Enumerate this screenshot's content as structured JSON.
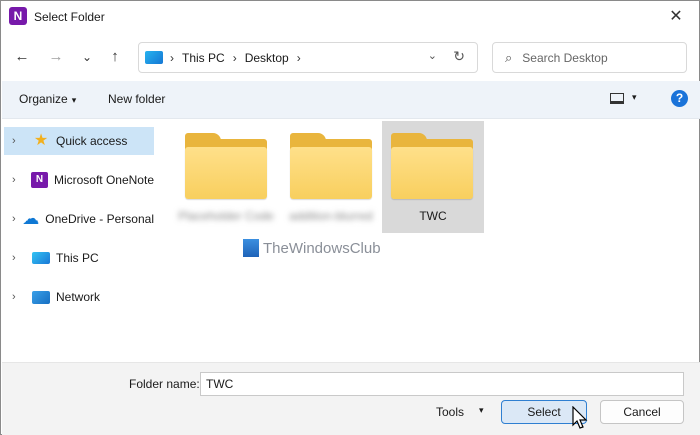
{
  "window": {
    "title": "Select Folder",
    "close_glyph": "✕",
    "app_icon_letter": "N"
  },
  "nav": {
    "back": "←",
    "forward": "→",
    "recent": "⌄",
    "up": "↑"
  },
  "address": {
    "crumbs": [
      "This PC",
      "Desktop"
    ],
    "sep": "›",
    "dropdown": "⌄",
    "refresh": "↻"
  },
  "search": {
    "placeholder": "Search Desktop",
    "icon": "⌕"
  },
  "toolbar": {
    "organize": "Organize",
    "new_folder": "New folder",
    "caret": "▾",
    "help": "?"
  },
  "sidebar": {
    "chevron": "›",
    "items": [
      {
        "label": "Quick access",
        "icon": "star-icon",
        "selected": true
      },
      {
        "label": "Microsoft OneNote",
        "icon": "onenote-icon"
      },
      {
        "label": "OneDrive - Personal",
        "icon": "cloud-icon"
      },
      {
        "label": "This PC",
        "icon": "monitor-icon"
      },
      {
        "label": "Network",
        "icon": "network-icon"
      }
    ]
  },
  "folders": [
    {
      "label": "Placeholder Code",
      "blurred": true
    },
    {
      "label": "addition-blurred",
      "blurred": true
    },
    {
      "label": "TWC",
      "blurred": false,
      "selected": true
    }
  ],
  "watermark": {
    "text": "TheWindowsClub"
  },
  "footer": {
    "folder_name_label": "Folder name:",
    "folder_name_value": "TWC",
    "tools_label": "Tools",
    "tools_caret": "▾",
    "select_label": "Select",
    "cancel_label": "Cancel"
  },
  "colors": {
    "accent": "#1a73d9",
    "selection": "#cce4f7",
    "folder": "#f8cf5e"
  }
}
